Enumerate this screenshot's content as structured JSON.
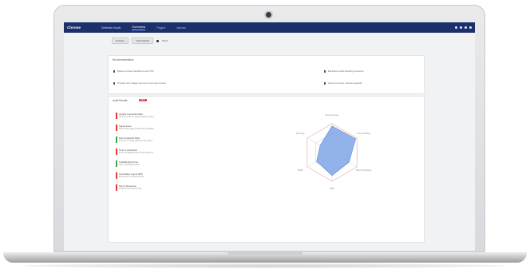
{
  "navbar": {
    "brand": "Chrome",
    "project": "Website Audit",
    "tabs": [
      "Overview",
      "Pages",
      "Issues"
    ],
    "active_tab": 0
  },
  "filters": {
    "select_1": "Desktop",
    "select_2": "Audit Details",
    "legend_label": "Score"
  },
  "suggestions": {
    "title": "Recommendations",
    "items": [
      "Reduce unused JavaScript and CSS",
      "Properly size images and serve next-gen formats",
      "Eliminate render-blocking resources",
      "Avoid enormous network payloads"
    ]
  },
  "audit": {
    "title": "Audit Results",
    "badge": "NEW",
    "items": [
      {
        "title": "Largest Contentful Paint",
        "desc": "Time to render the largest visible element",
        "status": "fail"
      },
      {
        "title": "Speed Index",
        "desc": "How quickly page contents are populated",
        "status": "fail"
      },
      {
        "title": "First Contentful Paint",
        "desc": "First text or image painted to the screen",
        "status": "pass"
      },
      {
        "title": "Time to Interactive",
        "desc": "Time until page becomes fully interactive",
        "status": "fail"
      },
      {
        "title": "Total Blocking Time",
        "desc": "Sum of blocking periods",
        "status": "pass"
      },
      {
        "title": "Cumulative Layout Shift",
        "desc": "Movement of visible elements",
        "status": "fail"
      },
      {
        "title": "Server Response",
        "desc": "Initial server response time",
        "status": "fail"
      }
    ]
  },
  "colors": {
    "navbar": "#1b2f6b",
    "fail": "#e53935",
    "pass": "#43a047",
    "radar_fill": "#7fa6e6",
    "radar_grid": "#cfd3da",
    "radar_outer": "#e9a7a0"
  },
  "radar": {
    "axes": [
      "Performance",
      "Accessibility",
      "Best Practices",
      "SEO",
      "PWA",
      "Security"
    ],
    "values": [
      0.92,
      0.95,
      0.68,
      0.8,
      0.62,
      0.48
    ]
  }
}
